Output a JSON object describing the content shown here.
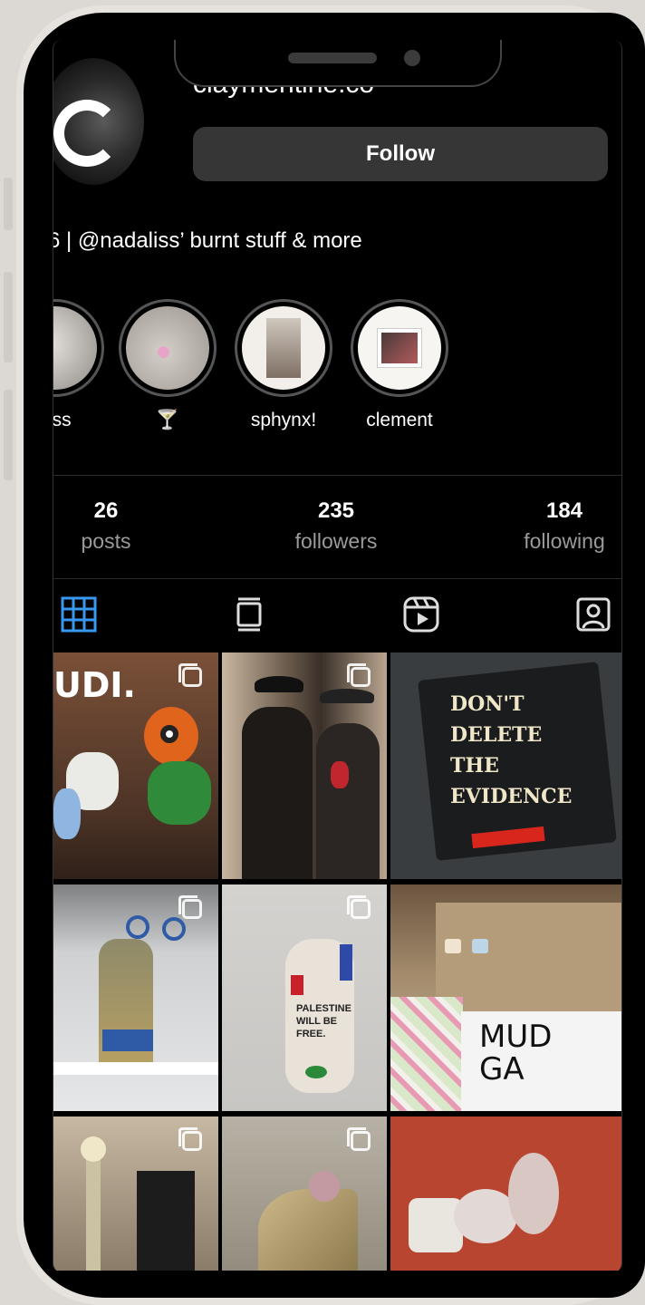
{
  "profile": {
    "handle": "claymentine.co",
    "follow_label": "Follow",
    "bio": "6 | @nadaliss’ burnt stuff & more"
  },
  "highlights": [
    {
      "label": "cess",
      "color": "#b9b6b2"
    },
    {
      "label": "🍸",
      "color": "#c9c2bd"
    },
    {
      "label": "sphynx!",
      "color": "#f0ece6"
    },
    {
      "label": "clement",
      "color": "#f6f4f0"
    }
  ],
  "stats": {
    "posts_count": "26",
    "posts_label": "posts",
    "followers_count": "235",
    "followers_label": "followers",
    "following_count": "184",
    "following_label": "following"
  },
  "tabs": [
    {
      "name": "grid-icon",
      "active": true
    },
    {
      "name": "feed-icon",
      "active": false
    },
    {
      "name": "reels-icon",
      "active": false
    },
    {
      "name": "tagged-icon",
      "active": false
    }
  ],
  "posts": [
    {
      "caption": "UDI.",
      "bg": "#6e4a35"
    },
    {
      "caption": "",
      "bg": "#3a332c"
    },
    {
      "caption": "DON'T DELETE THE EVIDENCE",
      "bg": "#2c2f33"
    },
    {
      "caption": "",
      "bg": "#8a8a84"
    },
    {
      "caption": "PALESTINE WILL BE FREE.",
      "bg": "#cfccc8"
    },
    {
      "caption": "MUD GA",
      "bg": "#a89478"
    },
    {
      "caption": "",
      "bg": "#8c7e6a"
    },
    {
      "caption": "",
      "bg": "#a79e90"
    },
    {
      "caption": "",
      "bg": "#b84a34"
    }
  ],
  "colors": {
    "accent": "#3897f0",
    "button_bg": "#363636"
  }
}
